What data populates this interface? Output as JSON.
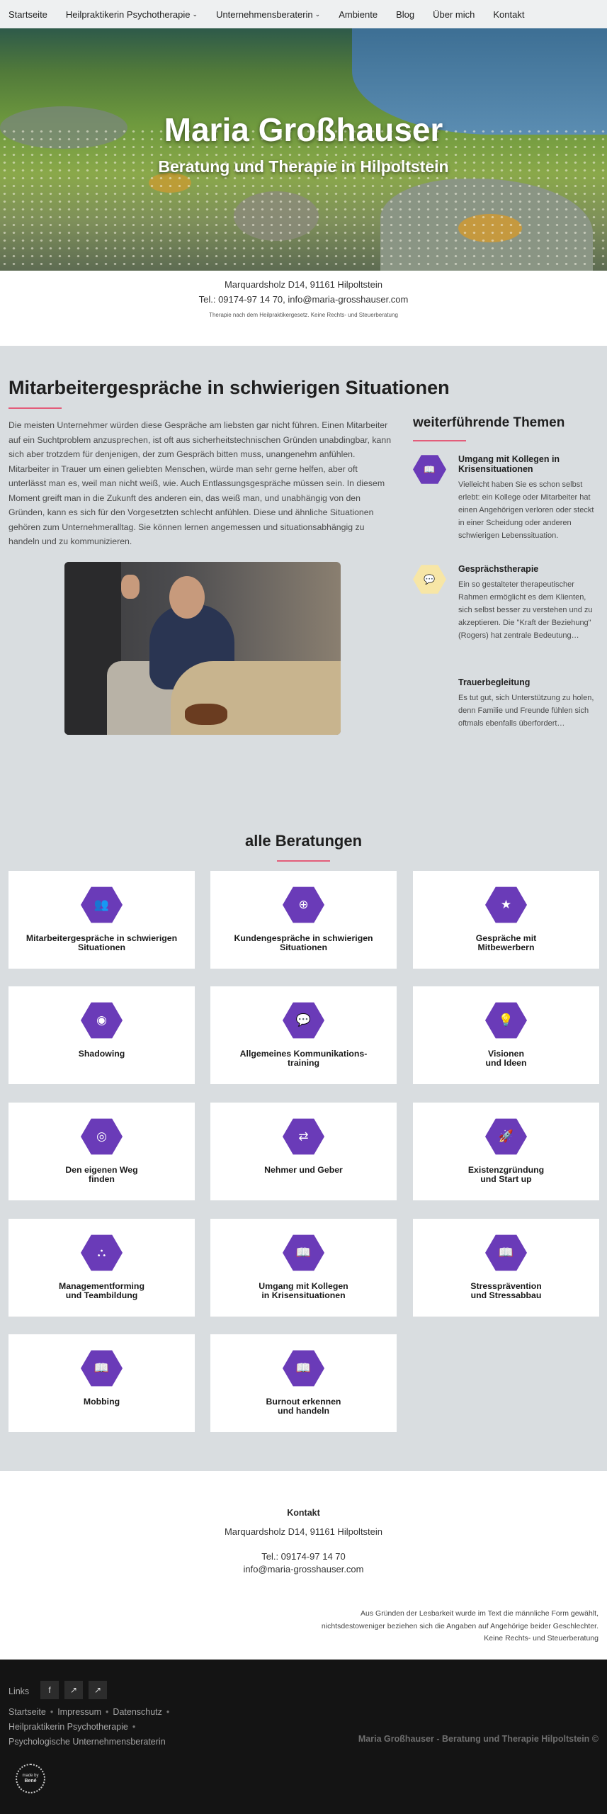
{
  "nav": {
    "items": [
      {
        "label": "Startseite",
        "dropdown": false
      },
      {
        "label": "Heilpraktikerin Psychotherapie",
        "dropdown": true
      },
      {
        "label": "Unternehmensberaterin",
        "dropdown": true
      },
      {
        "label": "Ambiente",
        "dropdown": false
      },
      {
        "label": "Blog",
        "dropdown": false
      },
      {
        "label": "Über mich",
        "dropdown": false
      },
      {
        "label": "Kontakt",
        "dropdown": false
      }
    ]
  },
  "hero": {
    "title": "Maria Großhauser",
    "subtitle": "Beratung und Therapie in Hilpoltstein"
  },
  "contact_top": {
    "address": "Marquardsholz D14, 91161 Hilpoltstein",
    "phone_email": "Tel.: 09174-97 14 70, info@maria-grosshauser.com",
    "disclaimer": "Therapie nach dem Heilpraktikergesetz. Keine Rechts- und Steuerberatung"
  },
  "main": {
    "title": "Mitarbeitergespräche in schwierigen Situationen",
    "text": "Die meisten Unternehmer würden diese Gespräche am liebsten gar nicht führen. Einen Mitarbeiter auf ein Suchtproblem anzusprechen, ist oft aus sicherheitstechnischen Gründen unabdingbar, kann sich aber trotzdem für denjenigen, der zum Gespräch bitten muss, unangenehm anfühlen. Mitarbeiter in Trauer um einen geliebten Menschen, würde man sehr gerne helfen, aber oft unterlässt man es, weil man nicht weiß, wie. Auch Entlassungsgespräche müssen sein. In diesem Moment greift man in die Zukunft des anderen ein, das weiß man, und unabhängig von den Gründen, kann es sich für den Vorgesetzten schlecht anfühlen. Diese und ähnliche Situationen gehören zum Unternehmeralltag. Sie können lernen angemessen und situationsabhängig zu handeln und zu kommunizieren."
  },
  "sidebar": {
    "title": "weiterführende Themen",
    "topics": [
      {
        "title": "Umgang mit Kollegen in Krisensituationen",
        "text": "Vielleicht haben Sie es schon selbst erlebt: ein Kollege oder Mitarbeiter hat einen Angehörigen verloren oder steckt in einer Scheidung oder anderen schwierigen Lebenssituation.",
        "icon": "book-icon",
        "color": "#6a3bb8"
      },
      {
        "title": "Gesprächstherapie",
        "text": "Ein so gestalteter therapeutischer Rahmen ermöglicht es dem Klienten, sich selbst besser zu verstehen und zu akzeptieren. Die \"Kraft der Beziehung\" (Rogers) hat zentrale Bedeutung…",
        "icon": "comments-icon",
        "color": "#f7e6a6"
      },
      {
        "title": "Trauerbegleitung",
        "text": "Es tut gut, sich Unterstützung zu holen, denn Familie und Freunde fühlen sich oftmals ebenfalls überfordert…"
      }
    ]
  },
  "all": {
    "title": "alle Beratungen",
    "cards": [
      {
        "label": "Mitarbeitergespräche in schwierigen\nSituationen",
        "icon": "users-icon",
        "glyph": "👥"
      },
      {
        "label": "Kundengespräche in schwierigen\nSituationen",
        "icon": "lifebuoy-icon",
        "glyph": "⊕"
      },
      {
        "label": "Gespräche mit\nMitbewerbern",
        "icon": "star-icon",
        "glyph": "★"
      },
      {
        "label": "Shadowing",
        "icon": "eye-icon",
        "glyph": "◉"
      },
      {
        "label": "Allgemeines Kommunikations-\ntraining",
        "icon": "comments-icon",
        "glyph": "💬"
      },
      {
        "label": "Visionen\nund Ideen",
        "icon": "lightbulb-icon",
        "glyph": "💡"
      },
      {
        "label": "Den eigenen Weg\nfinden",
        "icon": "compass-icon",
        "glyph": "◎"
      },
      {
        "label": "Nehmer und Geber",
        "icon": "exchange-icon",
        "glyph": "⇄"
      },
      {
        "label": "Existenzgründung\nund Start up",
        "icon": "rocket-icon",
        "glyph": "🚀"
      },
      {
        "label": "Managementforming\nund Teambildung",
        "icon": "sitemap-icon",
        "glyph": "⛬"
      },
      {
        "label": "Umgang mit Kollegen\nin Krisensituationen",
        "icon": "book-icon",
        "glyph": "📖"
      },
      {
        "label": "Stressprävention\nund Stressabbau",
        "icon": "book-icon",
        "glyph": "📖"
      },
      {
        "label": "Mobbing",
        "icon": "book-icon",
        "glyph": "📖"
      },
      {
        "label": "Burnout erkennen\nund handeln",
        "icon": "book-icon",
        "glyph": "📖"
      }
    ]
  },
  "contact_bottom": {
    "title": "Kontakt",
    "address": "Marquardsholz D14, 91161 Hilpoltstein",
    "phone": "Tel.: 09174-97 14 70",
    "email": "info@maria-grosshauser.com",
    "note_1": "Aus Gründen der Lesbarkeit wurde im Text die männliche Form gewählt,",
    "note_2": "nichtsdestoweniger beziehen sich die Angaben auf Angehörige beider Geschlechter.",
    "note_3": "Keine Rechts- und Steuerberatung"
  },
  "footer": {
    "links_title": "Links",
    "social": [
      {
        "icon": "facebook-icon",
        "glyph": "f"
      },
      {
        "icon": "external-link-icon",
        "glyph": "↗"
      },
      {
        "icon": "external-link-icon",
        "glyph": "↗"
      }
    ],
    "nav": [
      "Startseite",
      "Impressum",
      "Datenschutz",
      "Heilpraktikerin Psychotherapie",
      "Psychologische Unternehmensberaterin"
    ],
    "separator": "•",
    "copyright": "Maria Großhauser - Beratung und Therapie Hilpoltstein ©",
    "badge_line1": "made by",
    "badge_line2": "Bené"
  },
  "colors": {
    "accent_pink": "#e35d7a",
    "hex_purple": "#6a3bb8",
    "hex_yellow": "#f7e6a6",
    "bg_gray": "#d9dde0",
    "footer_bg": "#141414"
  }
}
